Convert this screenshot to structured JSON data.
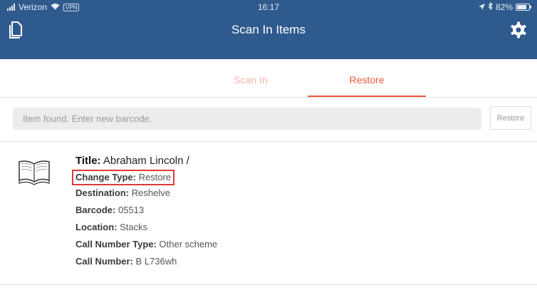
{
  "status_bar": {
    "carrier": "Verizon",
    "wifi_icon": "wifi-icon",
    "vpn_label": "VPN",
    "time": "16:17",
    "battery_percent": "82%",
    "battery_level": 0.82
  },
  "header": {
    "title": "Scan In Items",
    "left_icon": "document-icon",
    "right_icon": "gear-icon",
    "color": "#2f5a8d"
  },
  "tabs": [
    {
      "label": "Scan In",
      "active": false
    },
    {
      "label": "Restore",
      "active": true
    }
  ],
  "barcode": {
    "placeholder": "Item found. Enter new barcode.",
    "value": "",
    "button_label": "Restore"
  },
  "item": {
    "icon": "book-icon",
    "title_label": "Title:",
    "title_value": "Abraham Lincoln /",
    "fields": [
      {
        "label": "Change Type:",
        "value": "Restore",
        "highlighted": true
      },
      {
        "label": "Destination:",
        "value": "Reshelve"
      },
      {
        "label": "Barcode:",
        "value": "05513"
      },
      {
        "label": "Location:",
        "value": "Stacks"
      },
      {
        "label": "Call Number Type:",
        "value": "Other scheme"
      },
      {
        "label": "Call Number:",
        "value": "B L736wh"
      }
    ]
  },
  "colors": {
    "accent": "#ef5a3c",
    "highlight_box": "#e03a3a"
  }
}
